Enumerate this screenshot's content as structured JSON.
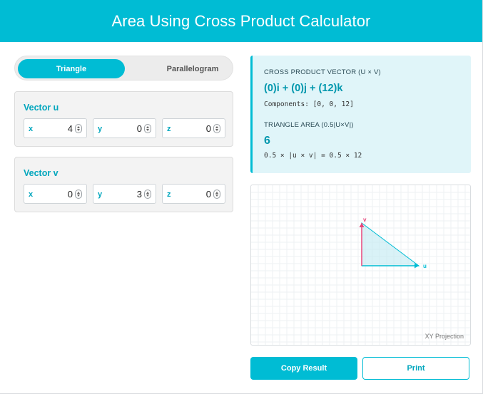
{
  "header": {
    "title": "Area Using Cross Product Calculator"
  },
  "mode_toggle": {
    "options": [
      "Triangle",
      "Parallelogram"
    ],
    "selected": "Triangle"
  },
  "vector_u": {
    "title": "Vector u",
    "x": {
      "label": "x",
      "value": "4"
    },
    "y": {
      "label": "y",
      "value": "0"
    },
    "z": {
      "label": "z",
      "value": "0"
    }
  },
  "vector_v": {
    "title": "Vector v",
    "x": {
      "label": "x",
      "value": "0"
    },
    "y": {
      "label": "y",
      "value": "3"
    },
    "z": {
      "label": "z",
      "value": "0"
    }
  },
  "result": {
    "cross_label": "CROSS PRODUCT VECTOR (U × V)",
    "cross_value": "(0)i + (0)j + (12)k",
    "components": "Components: [0, 0, 12]",
    "area_label": "TRIANGLE AREA (0.5|U×V|)",
    "area_value": "6",
    "area_formula": "0.5 × |u × v| = 0.5 × 12"
  },
  "graph": {
    "projection_label": "XY Projection",
    "u_label": "u",
    "v_label": "v",
    "u_vector": [
      4,
      0
    ],
    "v_vector": [
      0,
      3
    ]
  },
  "actions": {
    "copy_label": "Copy Result",
    "print_label": "Print"
  },
  "colors": {
    "accent": "#00bcd4",
    "u_vector": "#00bcd4",
    "v_vector": "#e8457a",
    "fill": "#bfeaf2"
  }
}
